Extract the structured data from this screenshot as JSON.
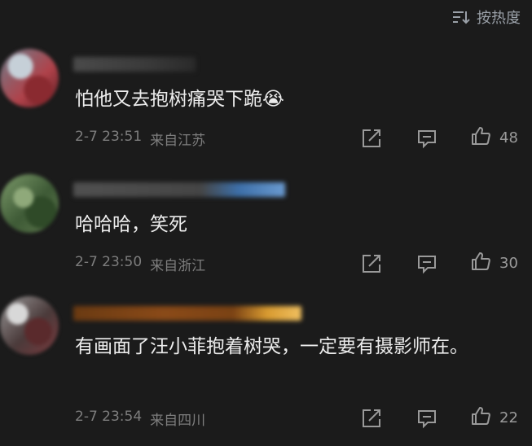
{
  "sort": {
    "label": "按热度",
    "icon": "sort-icon"
  },
  "comments": [
    {
      "text": "怕他又去抱树痛哭下跪😭",
      "date": "2-7 23:51",
      "location": "来自江苏",
      "likes": "48"
    },
    {
      "text": "哈哈哈，笑死",
      "date": "2-7 23:50",
      "location": "来自浙江",
      "likes": "30"
    },
    {
      "text": "有画面了汪小菲抱着树哭，一定要有摄影师在。",
      "date": "2-7 23:54",
      "location": "来自四川",
      "likes": "22"
    }
  ],
  "colors": {
    "background": "#1b1b1b",
    "text": "#ececec",
    "meta": "#7d7d7d",
    "icon": "#9a9a9a"
  }
}
